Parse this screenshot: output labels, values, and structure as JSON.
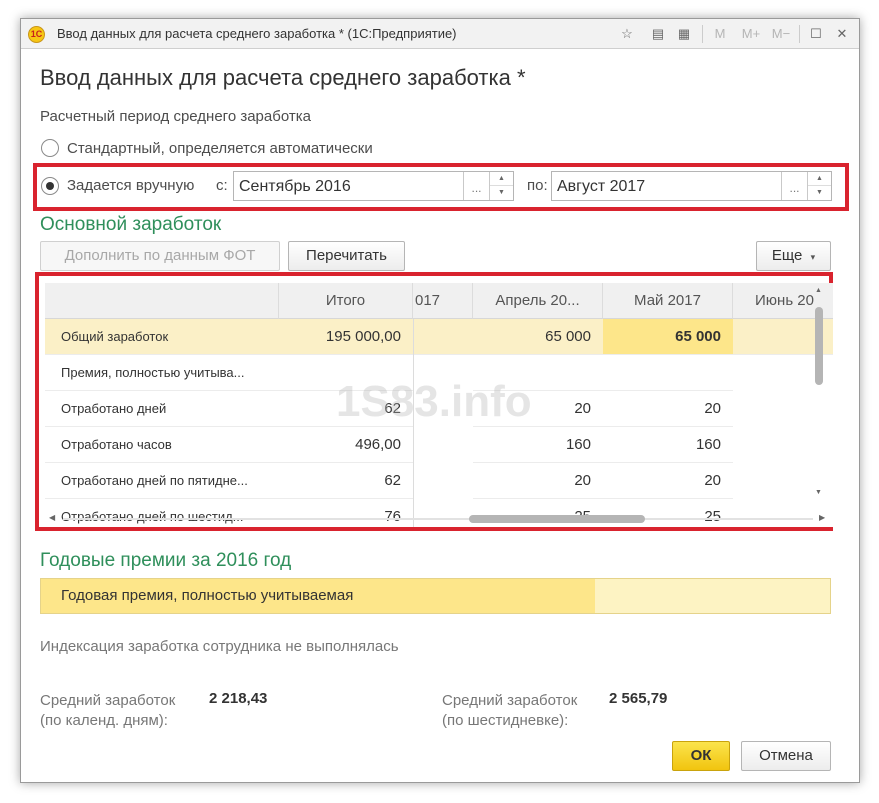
{
  "window": {
    "title": "Ввод данных для расчета среднего заработка * (1С:Предприятие)",
    "logo_text": "1С",
    "toolbar": [
      "M",
      "M+",
      "M−"
    ]
  },
  "form": {
    "title": "Ввод данных для расчета среднего заработка *",
    "period_label": "Расчетный период среднего заработка",
    "option_auto": "Стандартный, определяется автоматически",
    "option_manual": "Задается вручную",
    "from_label": "с:",
    "from_value": "Сентябрь 2016",
    "to_label": "по:",
    "to_value": "Август 2017",
    "choose_glyph": "..."
  },
  "earnings": {
    "section_title": "Основной заработок",
    "fill_button": "Дополнить по данным ФОТ",
    "reread_button": "Перечитать",
    "more_button": "Еще",
    "columns": [
      "Итого",
      "017",
      "Апрель 20...",
      "Май 2017",
      "Июнь 20"
    ],
    "rows": [
      {
        "name": "Общий заработок",
        "total": "195 000,00",
        "c1": "",
        "c2": "65 000",
        "c3": "65 000",
        "c4": ""
      },
      {
        "name": "Премия, полностью учитыва...",
        "total": "",
        "c1": "",
        "c2": "",
        "c3": "",
        "c4": ""
      },
      {
        "name": "Отработано дней",
        "total": "62",
        "c1": "",
        "c2": "20",
        "c3": "20",
        "c4": ""
      },
      {
        "name": "Отработано часов",
        "total": "496,00",
        "c1": "",
        "c2": "160",
        "c3": "160",
        "c4": ""
      },
      {
        "name": "Отработано дней по пятидне...",
        "total": "62",
        "c1": "",
        "c2": "20",
        "c3": "20",
        "c4": ""
      },
      {
        "name": "Отработано дней по шестид...",
        "total": "76",
        "c1": "",
        "c2": "25",
        "c3": "25",
        "c4": ""
      }
    ]
  },
  "watermark": "1S83.info",
  "bonuses": {
    "section_title": "Годовые премии за 2016 год",
    "row_text": "Годовая премия, полностью учитываемая"
  },
  "indexation_note": "Индексация заработка сотрудника не выполнялась",
  "results": {
    "calendar_label_1": "Средний заработок",
    "calendar_label_2": "(по календ. дням):",
    "calendar_value": "2 218,43",
    "sixday_label_1": "Средний заработок",
    "sixday_label_2": "(по шестидневке):",
    "sixday_value": "2 565,79"
  },
  "buttons": {
    "ok": "ОК",
    "cancel": "Отмена"
  },
  "colors": {
    "accent_green": "#2f8f5b",
    "highlight_red": "#d9232e",
    "primary_yellow": "#f1c40f"
  }
}
